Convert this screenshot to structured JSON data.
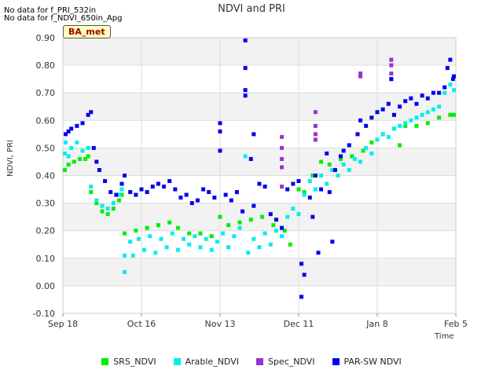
{
  "notes": [
    "No data for f_PRI_532in",
    "No data for f_NDVI_650in_Apg"
  ],
  "site_tag": "BA_met",
  "colors": {
    "SRS_NDVI": "#00ee00",
    "Arable_NDVI": "#00eeee",
    "Spec_NDVI": "#9a32cd",
    "PAR-SW NDVI": "#0000ee",
    "band": "#f2f2f2",
    "grid": "#dddddd"
  },
  "chart_data": {
    "type": "scatter",
    "title": "NDVI and PRI",
    "xlabel": "Time",
    "ylabel": "NDVI, PRI",
    "ylim": [
      -0.1,
      0.9
    ],
    "xlim": [
      "2017-09-18",
      "2018-02-05"
    ],
    "yticks": [
      "-0.10",
      "0.00",
      "0.10",
      "0.20",
      "0.30",
      "0.40",
      "0.50",
      "0.60",
      "0.70",
      "0.80",
      "0.90"
    ],
    "xticks": [
      {
        "label": "Sep 18",
        "date": "2017-09-18"
      },
      {
        "label": "Oct 16",
        "date": "2017-10-16"
      },
      {
        "label": "Nov 13",
        "date": "2017-11-13"
      },
      {
        "label": "Dec 11",
        "date": "2017-12-11"
      },
      {
        "label": "Jan 8",
        "date": "2018-01-08"
      },
      {
        "label": "Feb 5",
        "date": "2018-02-05"
      }
    ],
    "grid": true,
    "legend_position": "bottom",
    "series": [
      {
        "name": "SRS_NDVI",
        "points": [
          [
            "2017-09-18",
            0.42
          ],
          [
            "2017-09-20",
            0.44
          ],
          [
            "2017-09-22",
            0.45
          ],
          [
            "2017-09-24",
            0.46
          ],
          [
            "2017-09-26",
            0.46
          ],
          [
            "2017-09-27",
            0.47
          ],
          [
            "2017-09-28",
            0.34
          ],
          [
            "2017-09-30",
            0.3
          ],
          [
            "2017-10-02",
            0.27
          ],
          [
            "2017-10-04",
            0.26
          ],
          [
            "2017-10-06",
            0.28
          ],
          [
            "2017-10-08",
            0.31
          ],
          [
            "2017-10-09",
            0.33
          ],
          [
            "2017-10-10",
            0.19
          ],
          [
            "2017-10-14",
            0.2
          ],
          [
            "2017-10-18",
            0.21
          ],
          [
            "2017-10-22",
            0.22
          ],
          [
            "2017-10-26",
            0.23
          ],
          [
            "2017-10-29",
            0.21
          ],
          [
            "2017-11-02",
            0.19
          ],
          [
            "2017-11-06",
            0.19
          ],
          [
            "2017-11-10",
            0.18
          ],
          [
            "2017-11-13",
            0.25
          ],
          [
            "2017-11-16",
            0.22
          ],
          [
            "2017-11-20",
            0.23
          ],
          [
            "2017-11-24",
            0.24
          ],
          [
            "2017-11-28",
            0.25
          ],
          [
            "2017-12-02",
            0.22
          ],
          [
            "2017-12-06",
            0.2
          ],
          [
            "2017-12-08",
            0.15
          ],
          [
            "2017-12-11",
            0.35
          ],
          [
            "2017-12-13",
            0.34
          ],
          [
            "2017-12-16",
            0.4
          ],
          [
            "2017-12-19",
            0.45
          ],
          [
            "2017-12-22",
            0.44
          ],
          [
            "2017-12-26",
            0.46
          ],
          [
            "2017-12-30",
            0.47
          ],
          [
            "2018-01-03",
            0.49
          ],
          [
            "2018-01-06",
            0.52
          ],
          [
            "2018-01-10",
            0.55
          ],
          [
            "2018-01-14",
            0.57
          ],
          [
            "2018-01-18",
            0.58
          ],
          [
            "2018-01-22",
            0.58
          ],
          [
            "2018-01-26",
            0.59
          ],
          [
            "2018-01-30",
            0.61
          ],
          [
            "2018-02-03",
            0.62
          ],
          [
            "2018-02-05",
            0.62
          ],
          [
            "2018-01-16",
            0.51
          ]
        ]
      },
      {
        "name": "Arable_NDVI",
        "points": [
          [
            "2017-09-18",
            0.48
          ],
          [
            "2017-09-19",
            0.52
          ],
          [
            "2017-09-20",
            0.47
          ],
          [
            "2017-09-21",
            0.5
          ],
          [
            "2017-09-23",
            0.52
          ],
          [
            "2017-09-25",
            0.49
          ],
          [
            "2017-09-27",
            0.5
          ],
          [
            "2017-09-28",
            0.36
          ],
          [
            "2017-09-30",
            0.31
          ],
          [
            "2017-10-02",
            0.29
          ],
          [
            "2017-10-04",
            0.28
          ],
          [
            "2017-10-06",
            0.3
          ],
          [
            "2017-10-08",
            0.33
          ],
          [
            "2017-10-09",
            0.35
          ],
          [
            "2017-10-10",
            0.11
          ],
          [
            "2017-10-10",
            0.05
          ],
          [
            "2017-10-12",
            0.16
          ],
          [
            "2017-10-13",
            0.11
          ],
          [
            "2017-10-15",
            0.17
          ],
          [
            "2017-10-17",
            0.13
          ],
          [
            "2017-10-19",
            0.18
          ],
          [
            "2017-10-21",
            0.12
          ],
          [
            "2017-10-23",
            0.17
          ],
          [
            "2017-10-25",
            0.14
          ],
          [
            "2017-10-27",
            0.19
          ],
          [
            "2017-10-29",
            0.13
          ],
          [
            "2017-10-31",
            0.17
          ],
          [
            "2017-11-02",
            0.15
          ],
          [
            "2017-11-04",
            0.18
          ],
          [
            "2017-11-06",
            0.14
          ],
          [
            "2017-11-08",
            0.17
          ],
          [
            "2017-11-10",
            0.13
          ],
          [
            "2017-11-12",
            0.16
          ],
          [
            "2017-11-14",
            0.19
          ],
          [
            "2017-11-16",
            0.14
          ],
          [
            "2017-11-18",
            0.18
          ],
          [
            "2017-11-20",
            0.21
          ],
          [
            "2017-11-22",
            0.47
          ],
          [
            "2017-11-23",
            0.12
          ],
          [
            "2017-11-25",
            0.17
          ],
          [
            "2017-11-27",
            0.14
          ],
          [
            "2017-11-29",
            0.19
          ],
          [
            "2017-12-01",
            0.15
          ],
          [
            "2017-12-03",
            0.2
          ],
          [
            "2017-12-05",
            0.18
          ],
          [
            "2017-12-07",
            0.25
          ],
          [
            "2017-12-09",
            0.28
          ],
          [
            "2017-12-11",
            0.26
          ],
          [
            "2017-12-13",
            0.33
          ],
          [
            "2017-12-15",
            0.38
          ],
          [
            "2017-12-17",
            0.35
          ],
          [
            "2017-12-19",
            0.4
          ],
          [
            "2017-12-21",
            0.37
          ],
          [
            "2017-12-23",
            0.42
          ],
          [
            "2017-12-25",
            0.4
          ],
          [
            "2017-12-27",
            0.44
          ],
          [
            "2017-12-29",
            0.42
          ],
          [
            "2017-12-31",
            0.46
          ],
          [
            "2018-01-02",
            0.45
          ],
          [
            "2018-01-04",
            0.5
          ],
          [
            "2018-01-06",
            0.48
          ],
          [
            "2018-01-08",
            0.53
          ],
          [
            "2018-01-10",
            0.55
          ],
          [
            "2018-01-12",
            0.54
          ],
          [
            "2018-01-14",
            0.57
          ],
          [
            "2018-01-16",
            0.58
          ],
          [
            "2018-01-18",
            0.59
          ],
          [
            "2018-01-20",
            0.6
          ],
          [
            "2018-01-22",
            0.61
          ],
          [
            "2018-01-24",
            0.62
          ],
          [
            "2018-01-26",
            0.63
          ],
          [
            "2018-01-28",
            0.64
          ],
          [
            "2018-01-30",
            0.65
          ],
          [
            "2018-02-01",
            0.7
          ],
          [
            "2018-02-03",
            0.73
          ],
          [
            "2018-02-05",
            0.71
          ]
        ]
      },
      {
        "name": "Spec_NDVI",
        "points": [
          [
            "2017-12-05",
            0.54
          ],
          [
            "2017-12-05",
            0.5
          ],
          [
            "2017-12-05",
            0.46
          ],
          [
            "2017-12-05",
            0.43
          ],
          [
            "2017-12-05",
            0.36
          ],
          [
            "2017-12-17",
            0.63
          ],
          [
            "2017-12-17",
            0.58
          ],
          [
            "2017-12-17",
            0.55
          ],
          [
            "2017-12-17",
            0.53
          ],
          [
            "2018-01-02",
            0.77
          ],
          [
            "2018-01-02",
            0.76
          ],
          [
            "2018-01-13",
            0.82
          ],
          [
            "2018-01-13",
            0.8
          ],
          [
            "2018-01-13",
            0.77
          ],
          [
            "2018-01-13",
            0.75
          ]
        ]
      },
      {
        "name": "PAR-SW NDVI",
        "points": [
          [
            "2017-09-19",
            0.55
          ],
          [
            "2017-09-20",
            0.56
          ],
          [
            "2017-09-21",
            0.57
          ],
          [
            "2017-09-23",
            0.58
          ],
          [
            "2017-09-25",
            0.59
          ],
          [
            "2017-09-27",
            0.62
          ],
          [
            "2017-09-28",
            0.63
          ],
          [
            "2017-09-29",
            0.5
          ],
          [
            "2017-09-30",
            0.45
          ],
          [
            "2017-10-01",
            0.42
          ],
          [
            "2017-10-03",
            0.38
          ],
          [
            "2017-10-05",
            0.34
          ],
          [
            "2017-10-07",
            0.33
          ],
          [
            "2017-10-09",
            0.37
          ],
          [
            "2017-10-10",
            0.4
          ],
          [
            "2017-10-12",
            0.34
          ],
          [
            "2017-10-14",
            0.33
          ],
          [
            "2017-10-16",
            0.35
          ],
          [
            "2017-10-18",
            0.34
          ],
          [
            "2017-10-20",
            0.36
          ],
          [
            "2017-10-22",
            0.37
          ],
          [
            "2017-10-24",
            0.36
          ],
          [
            "2017-10-26",
            0.38
          ],
          [
            "2017-10-28",
            0.35
          ],
          [
            "2017-10-30",
            0.32
          ],
          [
            "2017-11-01",
            0.33
          ],
          [
            "2017-11-03",
            0.3
          ],
          [
            "2017-11-05",
            0.31
          ],
          [
            "2017-11-07",
            0.35
          ],
          [
            "2017-11-09",
            0.34
          ],
          [
            "2017-11-11",
            0.32
          ],
          [
            "2017-11-13",
            0.59
          ],
          [
            "2017-11-13",
            0.56
          ],
          [
            "2017-11-13",
            0.49
          ],
          [
            "2017-11-15",
            0.33
          ],
          [
            "2017-11-17",
            0.31
          ],
          [
            "2017-11-19",
            0.34
          ],
          [
            "2017-11-21",
            0.27
          ],
          [
            "2017-11-22",
            0.89
          ],
          [
            "2017-11-22",
            0.79
          ],
          [
            "2017-11-22",
            0.71
          ],
          [
            "2017-11-22",
            0.69
          ],
          [
            "2017-11-24",
            0.46
          ],
          [
            "2017-11-25",
            0.55
          ],
          [
            "2017-11-25",
            0.29
          ],
          [
            "2017-11-27",
            0.37
          ],
          [
            "2017-11-29",
            0.36
          ],
          [
            "2017-12-01",
            0.26
          ],
          [
            "2017-12-03",
            0.24
          ],
          [
            "2017-12-05",
            0.21
          ],
          [
            "2017-12-07",
            0.35
          ],
          [
            "2017-12-09",
            0.37
          ],
          [
            "2017-12-11",
            0.38
          ],
          [
            "2017-12-12",
            0.08
          ],
          [
            "2017-12-13",
            0.04
          ],
          [
            "2017-12-12",
            -0.04
          ],
          [
            "2017-12-15",
            0.32
          ],
          [
            "2017-12-16",
            0.25
          ],
          [
            "2017-12-17",
            0.4
          ],
          [
            "2017-12-18",
            0.12
          ],
          [
            "2017-12-19",
            0.35
          ],
          [
            "2017-12-21",
            0.48
          ],
          [
            "2017-12-22",
            0.34
          ],
          [
            "2017-12-23",
            0.16
          ],
          [
            "2017-12-24",
            0.42
          ],
          [
            "2017-12-26",
            0.47
          ],
          [
            "2017-12-27",
            0.49
          ],
          [
            "2017-12-29",
            0.51
          ],
          [
            "2018-01-01",
            0.55
          ],
          [
            "2018-01-02",
            0.6
          ],
          [
            "2018-01-04",
            0.58
          ],
          [
            "2018-01-06",
            0.61
          ],
          [
            "2018-01-08",
            0.63
          ],
          [
            "2018-01-10",
            0.64
          ],
          [
            "2018-01-12",
            0.66
          ],
          [
            "2018-01-13",
            0.75
          ],
          [
            "2018-01-14",
            0.62
          ],
          [
            "2018-01-16",
            0.65
          ],
          [
            "2018-01-18",
            0.67
          ],
          [
            "2018-01-20",
            0.68
          ],
          [
            "2018-01-22",
            0.66
          ],
          [
            "2018-01-24",
            0.69
          ],
          [
            "2018-01-26",
            0.68
          ],
          [
            "2018-01-28",
            0.7
          ],
          [
            "2018-01-30",
            0.7
          ],
          [
            "2018-02-01",
            0.72
          ],
          [
            "2018-02-02",
            0.79
          ],
          [
            "2018-02-03",
            0.82
          ],
          [
            "2018-02-04",
            0.75
          ],
          [
            "2018-02-05",
            0.76
          ]
        ]
      }
    ]
  }
}
